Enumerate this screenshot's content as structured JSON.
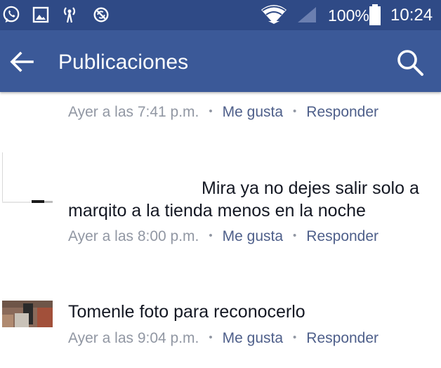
{
  "status_bar": {
    "battery": "100%",
    "time": "10:24",
    "icons": [
      "whatsapp-icon",
      "image-icon",
      "hotspot-icon",
      "blocked-sync-icon",
      "wifi-icon",
      "signal-icon",
      "battery-icon"
    ]
  },
  "app_bar": {
    "title": "Publicaciones",
    "back_icon": "arrow-left-icon",
    "search_icon": "search-icon"
  },
  "colors": {
    "status_bar": "#2f4a86",
    "app_bar": "#3b5998",
    "link": "#4e5f8a",
    "meta_gray": "#9197a3",
    "text": "#141823"
  },
  "comments": [
    {
      "text": "",
      "time": "Ayer a las 7:41 p.m.",
      "like": "Me gusta",
      "reply": "Responder",
      "separator": "•"
    },
    {
      "text_line1": "Mira ya no dejes salir solo a",
      "text_line2": "marqito a la tienda menos en la noche",
      "time": "Ayer a las 8:00 p.m.",
      "like": "Me gusta",
      "reply": "Responder",
      "separator": "•"
    },
    {
      "text": "Tomenle foto para reconocerlo",
      "time": "Ayer a las 9:04 p.m.",
      "like": "Me gusta",
      "reply": "Responder",
      "separator": "•"
    }
  ]
}
